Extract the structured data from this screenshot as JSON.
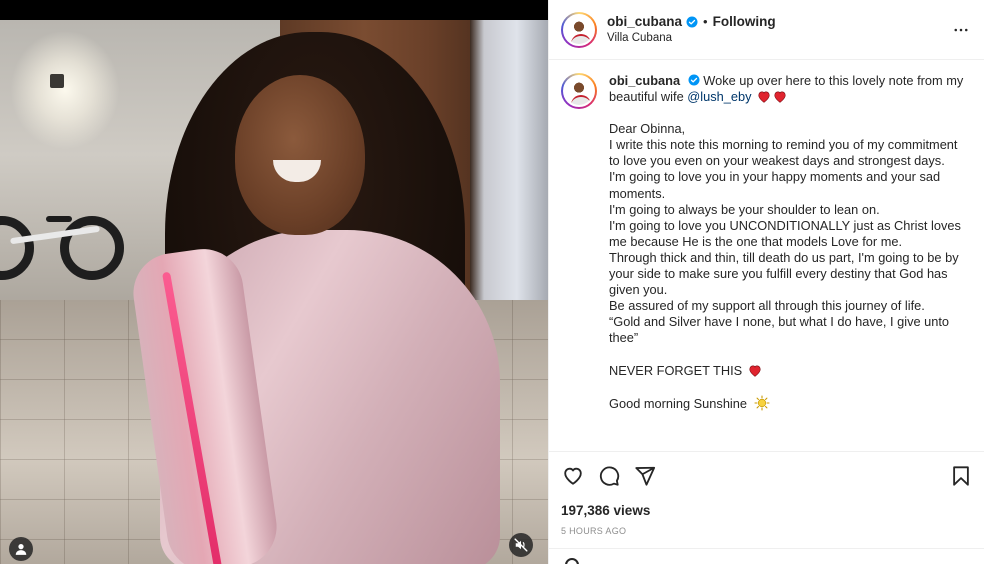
{
  "post": {
    "header": {
      "username": "obi_cubana",
      "verified": true,
      "separator": "•",
      "follow_status": "Following",
      "location": "Villa Cubana",
      "more_icon": "more-horizontal-icon"
    },
    "caption": {
      "username": "obi_cubana",
      "intro_text": "Woke up over here to this lovely note from my beautiful wife",
      "mention": "@lush_eby",
      "note_lines": [
        "Dear Obinna,",
        "I write this note this morning to remind you of my commitment to love you even on your weakest days and strongest days.",
        "I'm going to love you in your happy moments and your sad moments.",
        "I'm going to always be your shoulder to lean on.",
        "I'm going to love you UNCONDITIONALLY just as Christ loves me because He is the one that models Love for me.",
        "Through thick and thin, till death do us part, I'm going to be by your side to make sure you fulfill every destiny that God has given you.",
        "Be assured of my support all through this journey of life.",
        "“Gold and Silver have I none, but what I do have, I give unto thee”"
      ],
      "closing_1": "NEVER FORGET THIS",
      "closing_2": "Good morning Sunshine"
    },
    "stats": {
      "views": "197,386 views",
      "time_ago": "5 HOURS AGO"
    },
    "media": {
      "user_tag_icon": "person-tag-icon",
      "mute_icon": "speaker-muted-icon"
    },
    "colors": {
      "text": "#262626",
      "mention": "#00376b",
      "verified": "#0095f6",
      "heart": "#e0242f",
      "muted": "#8e8e8e",
      "divider": "#efefef"
    }
  }
}
